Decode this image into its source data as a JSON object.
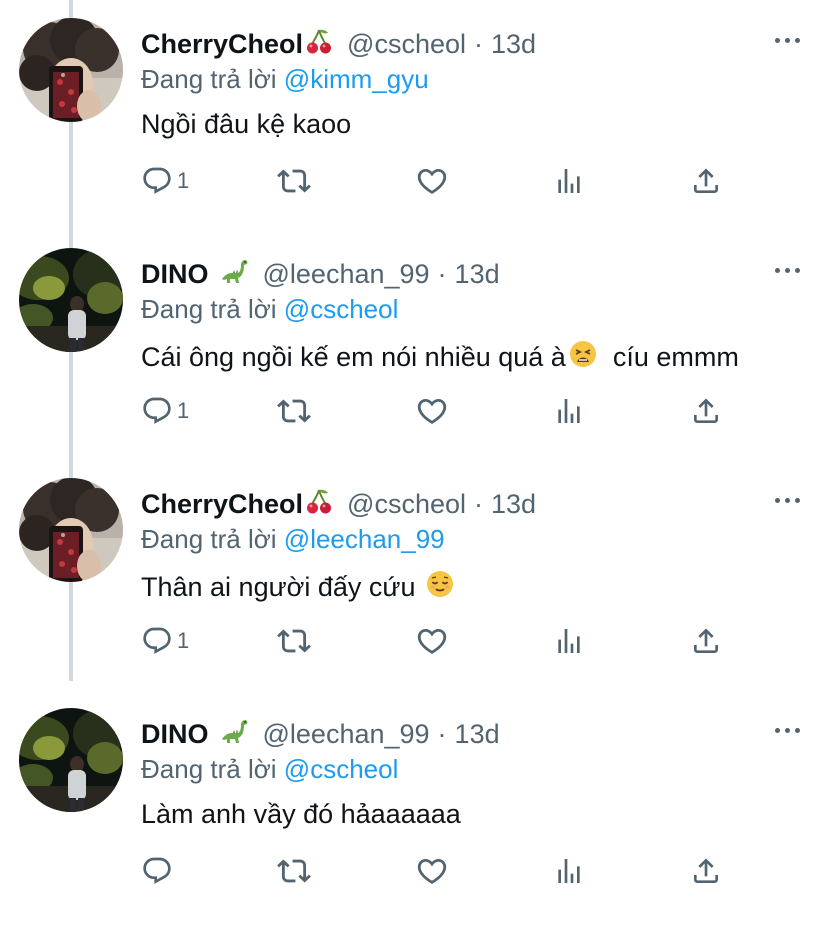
{
  "tweets": [
    {
      "author": "CherryCheol",
      "author_emoji": "cherries",
      "handle": "@cscheol",
      "separator": "·",
      "time": "13d",
      "reply_prefix": "Đang trả lời",
      "reply_to": "@kimm_gyu",
      "text": "Ngồi đâu kệ kaoo",
      "text_emoji": "",
      "text_suffix": "",
      "reply_count": "1",
      "avatar": "curly-hair-selfie"
    },
    {
      "author": "DINO",
      "author_emoji": "dinosaur",
      "handle": "@leechan_99",
      "separator": "·",
      "time": "13d",
      "reply_prefix": "Đang trả lời",
      "reply_to": "@cscheol",
      "text": "Cái ông ngồi kế em nói nhiều quá à",
      "text_emoji": "tired-face",
      "text_suffix": "  cíu emmm",
      "reply_count": "1",
      "avatar": "night-garden"
    },
    {
      "author": "CherryCheol",
      "author_emoji": "cherries",
      "handle": "@cscheol",
      "separator": "·",
      "time": "13d",
      "reply_prefix": "Đang trả lời",
      "reply_to": "@leechan_99",
      "text": "Thân ai người đấy cứu ",
      "text_emoji": "relieved-face",
      "text_suffix": "",
      "reply_count": "1",
      "avatar": "curly-hair-selfie"
    },
    {
      "author": "DINO",
      "author_emoji": "dinosaur",
      "handle": "@leechan_99",
      "separator": "·",
      "time": "13d",
      "reply_prefix": "Đang trả lời",
      "reply_to": "@cscheol",
      "text": "Làm anh vầy đó hảaaaaaa",
      "text_emoji": "",
      "text_suffix": "",
      "reply_count": "",
      "avatar": "night-garden"
    }
  ],
  "icons": {
    "reply": "speech-bubble-icon",
    "retweet": "retweet-icon",
    "like": "heart-icon",
    "stats": "bar-chart-icon",
    "share": "share-icon",
    "more": "more-icon"
  },
  "colors": {
    "link": "#1d9bf0",
    "secondary": "#536471",
    "text": "#0f1419",
    "thread_line": "#cfd9de"
  }
}
